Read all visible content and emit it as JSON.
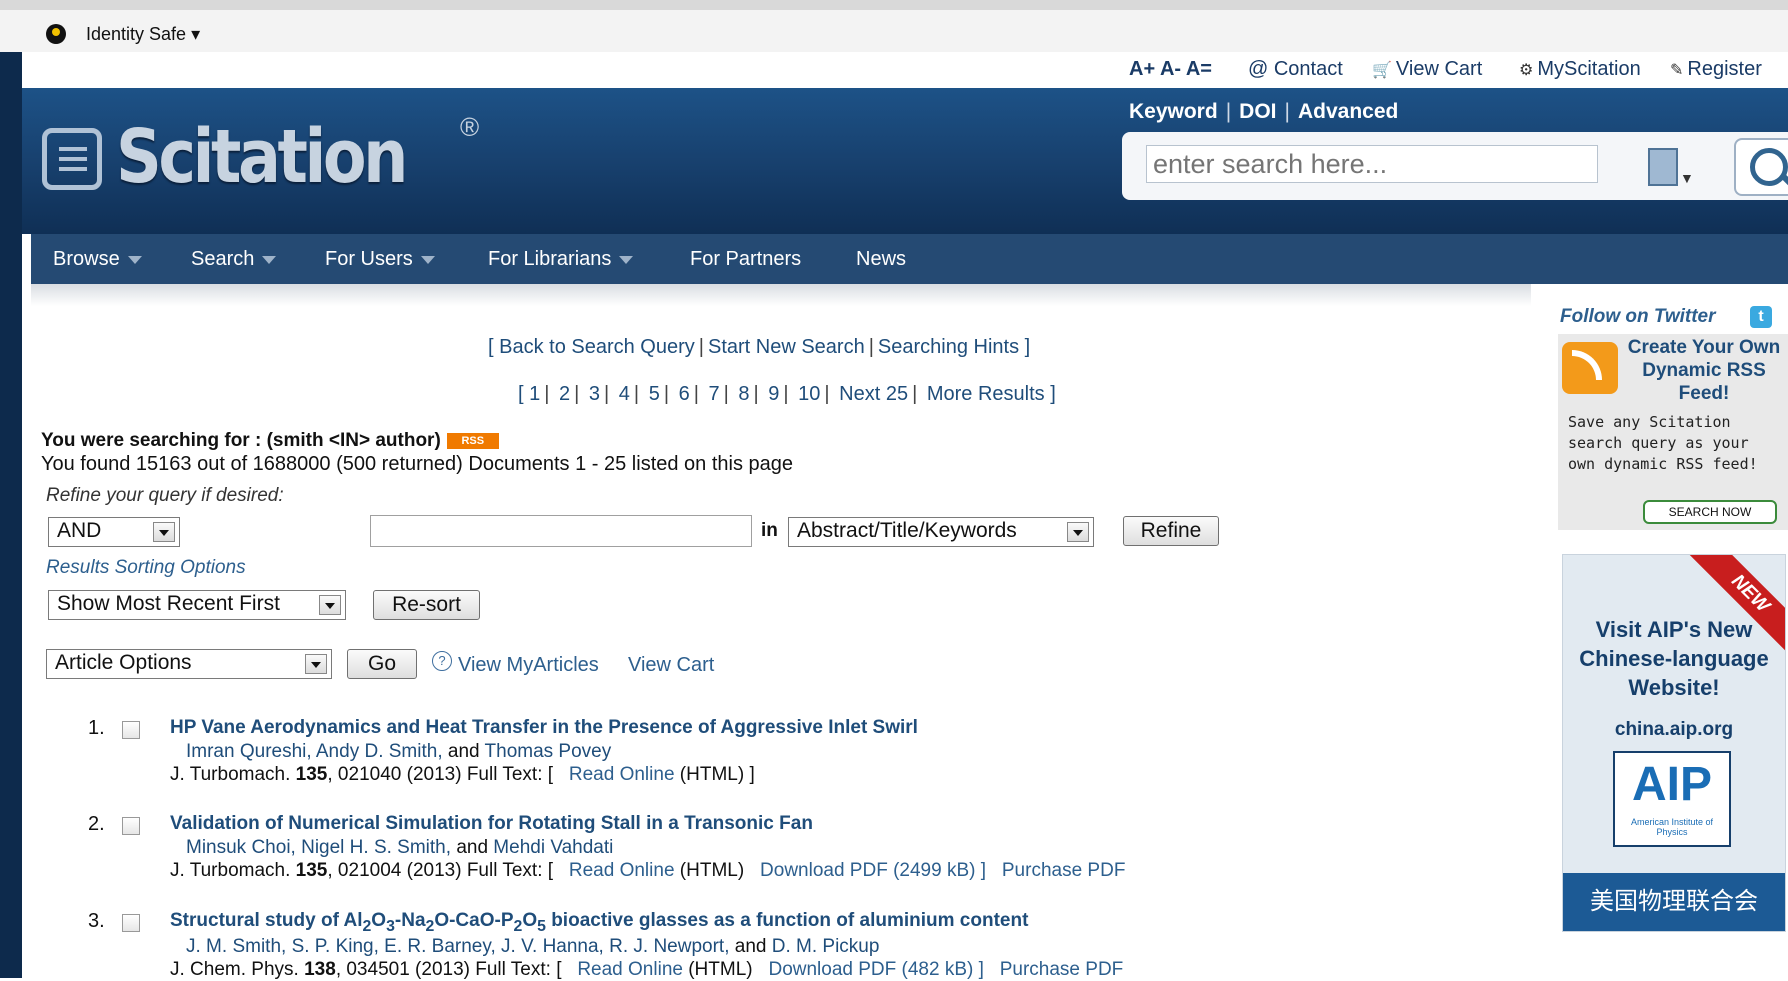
{
  "browser": {
    "toolbar_label": "Identity Safe ▾"
  },
  "util": {
    "font_sizes": "A+ A- A=",
    "contact": "@ Contact",
    "view_cart": "View Cart",
    "myscitation": "MyScitation",
    "register": "Register"
  },
  "header": {
    "brand": "Scitation",
    "brand_mark": "®",
    "search_modes": [
      "Keyword",
      "DOI",
      "Advanced"
    ],
    "search_placeholder": "enter search here..."
  },
  "nav": [
    "Browse",
    "Search",
    "For Users",
    "For Librarians",
    "For Partners",
    "News"
  ],
  "links_row": {
    "bracket_open": "[",
    "back": "Back to Search Query",
    "new_search": "Start New Search",
    "hints": "Searching Hints",
    "bracket_close": "]"
  },
  "pages": {
    "numbers": [
      "1",
      "2",
      "3",
      "4",
      "5",
      "6",
      "7",
      "8",
      "9",
      "10"
    ],
    "next": "Next 25",
    "more": "More Results"
  },
  "query": {
    "searching_for": "You were searching for : (smith <IN> author)",
    "rss": "RSS",
    "found": "You found 15163 out of 1688000 (500 returned)   Documents 1 - 25 listed on this page",
    "refine_label": "Refine your query if desired:",
    "operator": "AND",
    "refine_value": "",
    "in_label": "in",
    "field": "Abstract/Title/Keywords",
    "refine_button": "Refine",
    "sort_label": "Results Sorting Options",
    "sort_value": "Show Most Recent First",
    "resort_button": "Re-sort",
    "article_options": "Article Options",
    "go_button": "Go",
    "help": "?",
    "view_myarticles": "View MyArticles",
    "view_cart": "View Cart"
  },
  "results": [
    {
      "num": "1.",
      "title": "HP Vane Aerodynamics and Heat Transfer in the Presence of Aggressive Inlet Swirl",
      "authors_a": "Imran Qureshi, Andy D. Smith,",
      "authors_and": "and",
      "authors_b": "Thomas Povey",
      "journal": "J. Turbomach.",
      "volume": "135",
      "ref": ", 021040 (2013)  Full Text: [",
      "read": "Read Online",
      "html": "(HTML) ]",
      "pdf": "",
      "purchase": ""
    },
    {
      "num": "2.",
      "title": "Validation of Numerical Simulation for Rotating Stall in a Transonic Fan",
      "authors_a": "Minsuk Choi, Nigel H. S. Smith,",
      "authors_and": "and",
      "authors_b": "Mehdi Vahdati",
      "journal": "J. Turbomach.",
      "volume": "135",
      "ref": ", 021004 (2013)  Full Text: [",
      "read": "Read Online",
      "html": "(HTML)",
      "pdf": "Download PDF (2499 kB) ]",
      "purchase": "Purchase PDF"
    },
    {
      "num": "3.",
      "title_parts": [
        "Structural study of Al",
        "2",
        "O",
        "3",
        "-Na",
        "2",
        "O-CaO-P",
        "2",
        "O",
        "5",
        " bioactive glasses as a function of aluminium content"
      ],
      "authors_a": "J. M. Smith, S. P. King, E. R. Barney, J. V. Hanna, R. J. Newport,",
      "authors_and": "and",
      "authors_b": "D. M. Pickup",
      "journal": "J. Chem. Phys.",
      "volume": "138",
      "ref": ", 034501 (2013)  Full Text: [",
      "read": "Read Online",
      "html": "(HTML)",
      "pdf": "Download PDF (482 kB) ]",
      "purchase": "Purchase PDF"
    }
  ],
  "sidebar": {
    "twitter": "Follow on Twitter",
    "rss_head": "Create Your Own Dynamic RSS Feed!",
    "rss_body": "Save any Scitation search query as your own dynamic RSS feed!",
    "rss_button": "SEARCH NOW",
    "ad_ribbon": "NEW",
    "ad_title": "Visit AIP's New Chinese-language Website!",
    "ad_url": "china.aip.org",
    "ad_logo": "AIP",
    "ad_logo_sub": "American Institute of Physics",
    "ad_footer": "美国物理联合会"
  }
}
